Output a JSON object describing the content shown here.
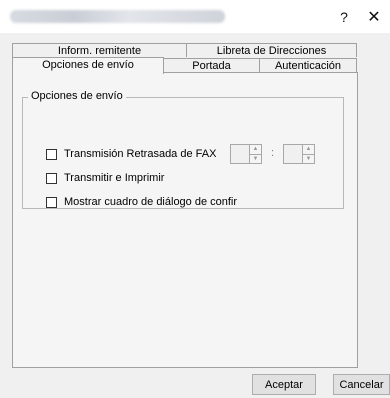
{
  "titlebar": {
    "help_label": "?",
    "close_label": "✕"
  },
  "tabs": {
    "row1": [
      "Inform. remitente",
      "Libreta de Direcciones"
    ],
    "row2": [
      "Opciones de envío",
      "Portada",
      "Autenticación"
    ]
  },
  "group": {
    "title": "Opciones de envío"
  },
  "options": [
    {
      "label": "Transmisión Retrasada de FAX",
      "checked": false
    },
    {
      "label": "Transmitir e Imprimir",
      "checked": false
    },
    {
      "label": "Mostrar cuadro de diálogo de confir",
      "checked": false
    }
  ],
  "time": {
    "separator": ":",
    "up_arrow": "▲",
    "down_arrow": "▼"
  },
  "buttons": {
    "ok": "Aceptar",
    "cancel": "Cancelar"
  }
}
